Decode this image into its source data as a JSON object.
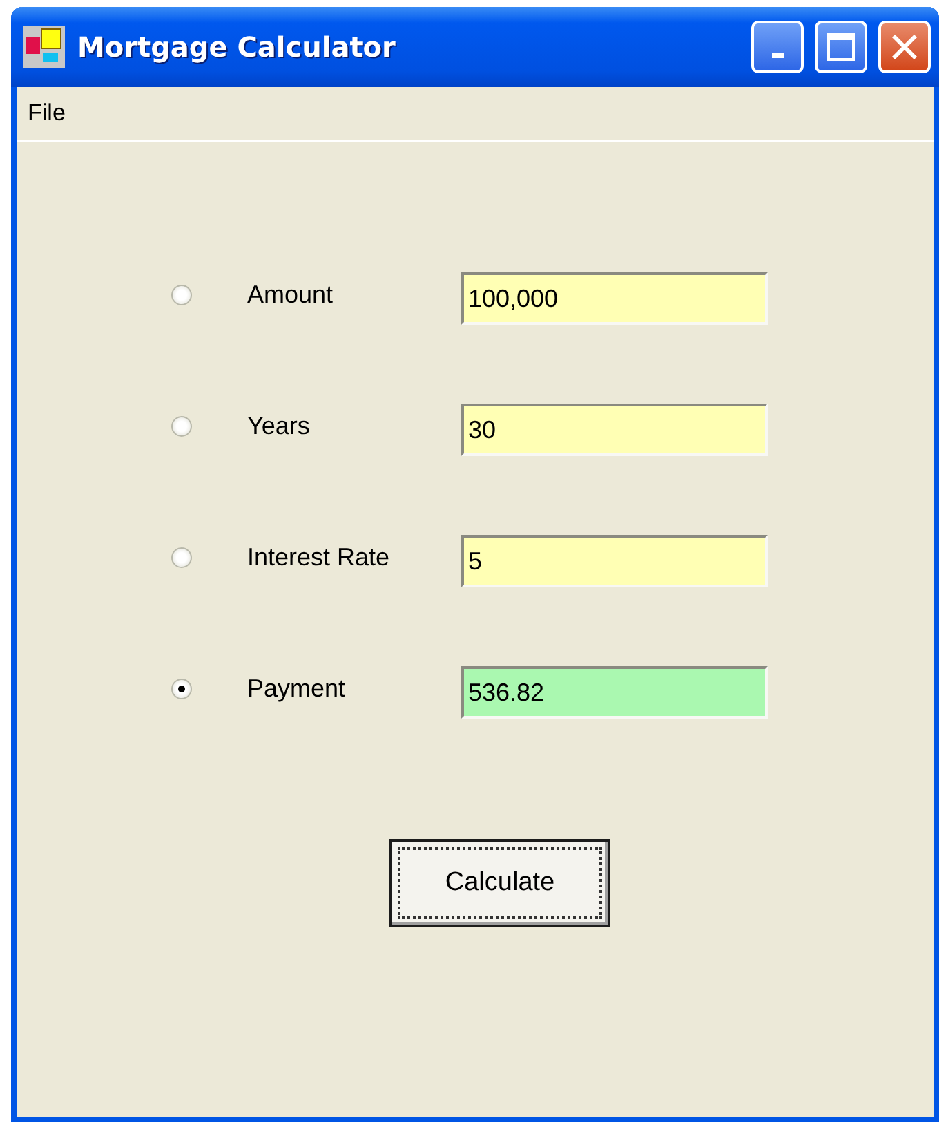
{
  "window": {
    "title": "Mortgage Calculator"
  },
  "menu": [
    "File"
  ],
  "rows": [
    {
      "label": "Amount",
      "value": "100,000",
      "selected": false,
      "color": "#ffffb4"
    },
    {
      "label": "Years",
      "value": "30",
      "selected": false,
      "color": "#ffffb4"
    },
    {
      "label": "Interest Rate",
      "value": "5",
      "selected": false,
      "color": "#ffffb4"
    },
    {
      "label": "Payment",
      "value": "536.82",
      "selected": true,
      "color": "#aaf8b0"
    }
  ],
  "button": {
    "label": "Calculate",
    "focused": true
  }
}
